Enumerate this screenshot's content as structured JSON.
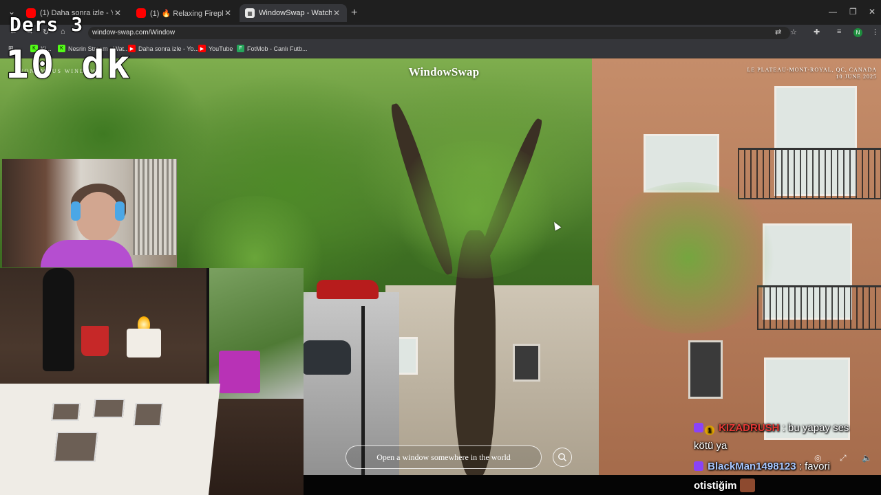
{
  "overlay": {
    "lesson": "Ders 3",
    "timer": "10 dk"
  },
  "browser": {
    "tabs": [
      {
        "title": "(1) Daha sonra izle - YouTube",
        "icon": "youtube-icon"
      },
      {
        "title": "(1) 🔥 Relaxing Fireplace Sounds",
        "icon": "youtube-icon"
      },
      {
        "title": "WindowSwap - Watch windows",
        "icon": "windowswap-icon",
        "active": true
      }
    ],
    "url": "window-swap.com/Window",
    "profile_initial": "N",
    "bookmarks": [
      {
        "label": "Ki...",
        "icon": "kick-icon"
      },
      {
        "label": "Nesrin Stream - Wat...",
        "icon": "kick-icon"
      },
      {
        "label": "Daha sonra izle - Yo...",
        "icon": "youtube-icon"
      },
      {
        "label": "YouTube",
        "icon": "youtube-icon"
      },
      {
        "label": "FotMob - Canlı Futb...",
        "icon": "fotmob-icon"
      }
    ]
  },
  "windowswap": {
    "brand": "WindowSwap",
    "left_label": "ANONYMOUS WINDOW",
    "location_line1": "LE PLATEAU-MONT-ROYAL, QC, CANADA",
    "location_line2": "10 JUNE 2025",
    "search_placeholder": "Open a window somewhere in the world"
  },
  "chat": [
    {
      "user": "KIZADRUSH",
      "separator": ":",
      "message": "bu yapay ses",
      "continuation": "kötü ya"
    },
    {
      "user": "BlackMan1498123",
      "separator": ":",
      "message": "favori",
      "continuation": "otistiğim"
    }
  ],
  "colors": {
    "accent_user1": "#e53935",
    "accent_user2": "#a8c7ff",
    "twitch": "#8a43f7"
  }
}
